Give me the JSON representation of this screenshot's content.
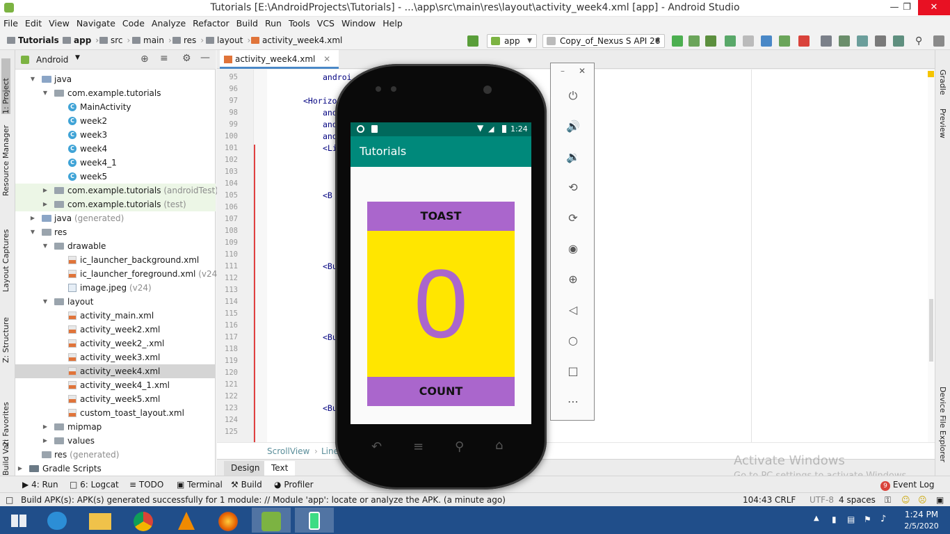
{
  "window": {
    "title": "Tutorials [E:\\AndroidProjects\\Tutorials] - ...\\app\\src\\main\\res\\layout\\activity_week4.xml [app] - Android Studio"
  },
  "menu": [
    "File",
    "Edit",
    "View",
    "Navigate",
    "Code",
    "Analyze",
    "Refactor",
    "Build",
    "Run",
    "Tools",
    "VCS",
    "Window",
    "Help"
  ],
  "breadcrumb": [
    "Tutorials",
    "app",
    "src",
    "main",
    "res",
    "layout",
    "activity_week4.xml"
  ],
  "toolbar": {
    "module": "app",
    "device": "Copy_of_Nexus S API 26"
  },
  "left_tabs": [
    "1: Project",
    "Resource Manager",
    "Layout Captures",
    "Z: Structure",
    "2: Favorites",
    "Build Variants"
  ],
  "project": {
    "view": "Android",
    "tree": [
      {
        "label": "java",
        "extra": ""
      },
      {
        "label": "com.example.tutorials",
        "extra": ""
      },
      {
        "label": "MainActivity",
        "extra": ""
      },
      {
        "label": "week2",
        "extra": ""
      },
      {
        "label": "week3",
        "extra": ""
      },
      {
        "label": "week4",
        "extra": ""
      },
      {
        "label": "week4_1",
        "extra": ""
      },
      {
        "label": "week5",
        "extra": ""
      },
      {
        "label": "com.example.tutorials",
        "extra": "(androidTest)"
      },
      {
        "label": "com.example.tutorials",
        "extra": "(test)"
      },
      {
        "label": "java",
        "extra": "(generated)"
      },
      {
        "label": "res",
        "extra": ""
      },
      {
        "label": "drawable",
        "extra": ""
      },
      {
        "label": "ic_launcher_background.xml",
        "extra": ""
      },
      {
        "label": "ic_launcher_foreground.xml",
        "extra": "(v24)"
      },
      {
        "label": "image.jpeg",
        "extra": "(v24)"
      },
      {
        "label": "layout",
        "extra": ""
      },
      {
        "label": "activity_main.xml",
        "extra": ""
      },
      {
        "label": "activity_week2.xml",
        "extra": ""
      },
      {
        "label": "activity_week2_.xml",
        "extra": ""
      },
      {
        "label": "activity_week3.xml",
        "extra": ""
      },
      {
        "label": "activity_week4.xml",
        "extra": ""
      },
      {
        "label": "activity_week4_1.xml",
        "extra": ""
      },
      {
        "label": "activity_week5.xml",
        "extra": ""
      },
      {
        "label": "custom_toast_layout.xml",
        "extra": ""
      },
      {
        "label": "mipmap",
        "extra": ""
      },
      {
        "label": "values",
        "extra": ""
      },
      {
        "label": "res",
        "extra": "(generated)"
      },
      {
        "label": "Gradle Scripts",
        "extra": ""
      }
    ]
  },
  "editor": {
    "tab": "activity_week4.xml",
    "line_numbers": [
      "95",
      "96",
      "97",
      "98",
      "99",
      "100",
      "101",
      "102",
      "103",
      "104",
      "105",
      "106",
      "107",
      "108",
      "109",
      "110",
      "111",
      "112",
      "113",
      "114",
      "115",
      "116",
      "117",
      "118",
      "119",
      "120",
      "121",
      "122",
      "123",
      "124",
      "125"
    ],
    "code_fragments": [
      {
        "line": "95",
        "text": "androi"
      },
      {
        "line": "97",
        "text": "<Horizo"
      },
      {
        "line": "98",
        "text": "and"
      },
      {
        "line": "99",
        "text": "and"
      },
      {
        "line": "100",
        "text": "and"
      },
      {
        "line": "101",
        "text": "<Li"
      },
      {
        "line": "105",
        "text": "<B"
      },
      {
        "line": "111",
        "text": "<Bu"
      },
      {
        "line": "117",
        "text": "<Bu"
      },
      {
        "line": "123",
        "text": "<Bu"
      }
    ],
    "path": [
      "ScrollView",
      "Linea"
    ],
    "design_tabs": [
      "Design",
      "Text"
    ]
  },
  "right_tabs": [
    "Gradle",
    "Preview",
    "Device File Explorer"
  ],
  "emulator": {
    "time": "1:24",
    "app_title": "Tutorials",
    "toast_label": "TOAST",
    "count_value": "0",
    "count_label": "COUNT"
  },
  "bottom_tools": [
    "4: Run",
    "6: Logcat",
    "TODO",
    "Terminal",
    "Build",
    "Profiler"
  ],
  "event_log": {
    "badge": "9",
    "label": "Event Log"
  },
  "status": {
    "message": "Build APK(s): APK(s) generated successfully for 1 module: // Module 'app': locate or analyze the APK. (a minute ago)",
    "position": "104:43",
    "line_sep": "CRLF",
    "encoding": "UTF-8",
    "indent": "4 spaces"
  },
  "watermark": {
    "line1": "Activate Windows",
    "line2": "Go to PC settings to activate Windows."
  },
  "taskbar": {
    "time": "1:24 PM",
    "date": "2/5/2020"
  },
  "colors": {
    "accent": "#00897b",
    "status_bar": "#00695c",
    "button": "#aa66cc",
    "counter_bg": "#ffe600"
  }
}
